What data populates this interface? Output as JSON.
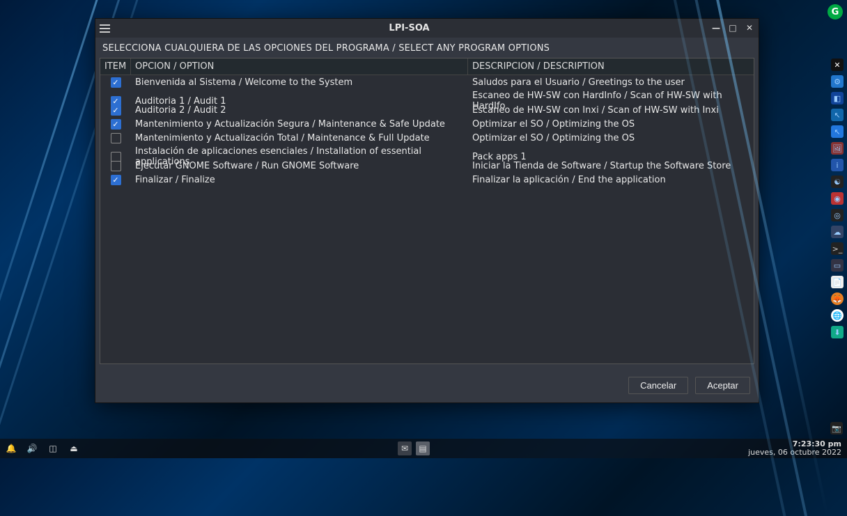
{
  "window": {
    "title": "LPI-SOA",
    "instruction": "SELECCIONA CUALQUIERA DE LAS OPCIONES DEL PROGRAMA / SELECT ANY PROGRAM OPTIONS",
    "columns": {
      "item": "ITEM",
      "option": "OPCION / OPTION",
      "description": "DESCRIPCION / DESCRIPTION"
    },
    "rows": [
      {
        "checked": true,
        "option": "Bienvenida al Sistema / Welcome to the System",
        "description": "Saludos para el Usuario / Greetings to the user"
      },
      {
        "checked": true,
        "option": "Auditoria 1 / Audit 1",
        "description": "Escaneo de HW-SW con HardInfo / Scan of HW-SW with HardIfo"
      },
      {
        "checked": true,
        "option": "Auditoria 2 / Audit 2",
        "description": "Escaneo de HW-SW con Inxi / Scan of HW-SW with Inxi"
      },
      {
        "checked": true,
        "option": "Mantenimiento y Actualización Segura / Maintenance & Safe Update",
        "description": "Optimizar el SO / Optimizing the OS"
      },
      {
        "checked": false,
        "option": "Mantenimiento y Actualización Total / Maintenance & Full Update",
        "description": "Optimizar el SO / Optimizing the OS"
      },
      {
        "checked": false,
        "option": "Instalación de aplicaciones esenciales / Installation of essential applications",
        "description": "Pack apps 1"
      },
      {
        "checked": false,
        "option": "Ejecutar GNOME Software / Run GNOME Software",
        "description": "Iniciar la Tienda de Software / Startup the Software Store"
      },
      {
        "checked": true,
        "option": "Finalizar / Finalize",
        "description": "Finalizar la aplicación / End the application"
      }
    ],
    "buttons": {
      "cancel": "Cancelar",
      "accept": "Aceptar"
    }
  },
  "taskbar": {
    "time": "7:23:30 pm",
    "date": "jueves, 06 octubre 2022"
  },
  "corner_badge": "G"
}
